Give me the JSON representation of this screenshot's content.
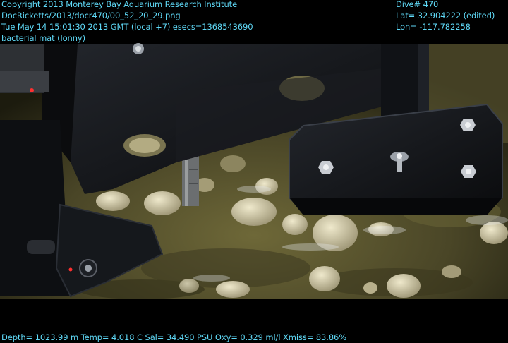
{
  "overlay": {
    "top_left": [
      "Copyright 2013 Monterey Bay Aquarium Research Institute",
      "DocRicketts/2013/docr470/00_52_20_29.png",
      "Tue May 14 15:01:30 2013 GMT (local +7)  esecs=1368543690",
      "bacterial mat (lonny)"
    ],
    "top_right": [
      "Dive# 470",
      "Lat= 32.904222 (edited)",
      "Lon= -117.782258"
    ],
    "bottom": "Depth= 1023.99 m  Temp= 4.018 C  Sal= 34.490 PSU  Oxy= 0.329 ml/l  Xmiss= 83.86%",
    "text_color": "#5fd9f7"
  },
  "scene": {
    "subject": "ROV sampling arm over seafloor with clams and bacterial mat",
    "palette": {
      "sediment": "#5a5530",
      "sediment_dark": "#2e2c16",
      "clam": "#d9d2b0",
      "machinery": "#111316",
      "machinery_edge": "#3a3f48",
      "bolt": "#c8ccd2"
    }
  }
}
